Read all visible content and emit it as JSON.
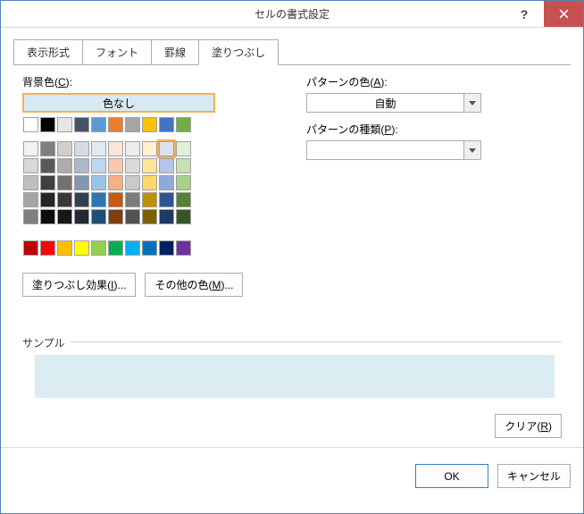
{
  "title": "セルの書式設定",
  "tabs": [
    "表示形式",
    "フォント",
    "罫線",
    "塗りつぶし"
  ],
  "activeTab": 3,
  "bgColorLabel": "背景色(C):",
  "noColorLabel": "色なし",
  "fillEffectsBtn": "塗りつぶし効果(I)...",
  "moreColorsBtn": "その他の色(M)...",
  "patternColorLabel": "パターンの色(A):",
  "patternColorValue": "自動",
  "patternTypeLabel": "パターンの種類(P):",
  "patternTypeValue": "",
  "sampleLabel": "サンプル",
  "clearBtn": "クリア(R)",
  "okBtn": "OK",
  "cancelBtn": "キャンセル",
  "sampleColor": "#dbecf2",
  "paletteRow1": [
    "#ffffff",
    "#000000",
    "#e7e6e6",
    "#44546a",
    "#5b9bd5",
    "#ed7d31",
    "#a5a5a5",
    "#ffc000",
    "#4472c4",
    "#70ad47"
  ],
  "paletteGrid": [
    [
      "#f2f2f2",
      "#7f7f7f",
      "#d0cece",
      "#d6dce4",
      "#deebf6",
      "#fce4d6",
      "#ededed",
      "#fff2cc",
      "#d9e2f3",
      "#e2efd9"
    ],
    [
      "#d8d8d8",
      "#595959",
      "#aeabab",
      "#adb9ca",
      "#bdd7ee",
      "#f7caac",
      "#dbdbdb",
      "#fee599",
      "#b4c6e7",
      "#c5e0b3"
    ],
    [
      "#bfbfbf",
      "#3f3f3f",
      "#757070",
      "#8496b0",
      "#9cc3e5",
      "#f4b183",
      "#c9c9c9",
      "#ffd965",
      "#8eaadb",
      "#a8d08d"
    ],
    [
      "#a5a5a5",
      "#262626",
      "#3a3838",
      "#323f4f",
      "#2e75b5",
      "#c55a11",
      "#7b7b7b",
      "#bf9000",
      "#2f5496",
      "#538135"
    ],
    [
      "#7f7f7f",
      "#0c0c0c",
      "#171616",
      "#222a35",
      "#1e4e79",
      "#833c0b",
      "#525252",
      "#7f6000",
      "#1f3864",
      "#375623"
    ]
  ],
  "standardRow": [
    "#c00000",
    "#ff0000",
    "#ffc000",
    "#ffff00",
    "#92d050",
    "#00b050",
    "#00b0f0",
    "#0070c0",
    "#002060",
    "#7030a0"
  ],
  "selectedSwatch": [
    0,
    8
  ]
}
